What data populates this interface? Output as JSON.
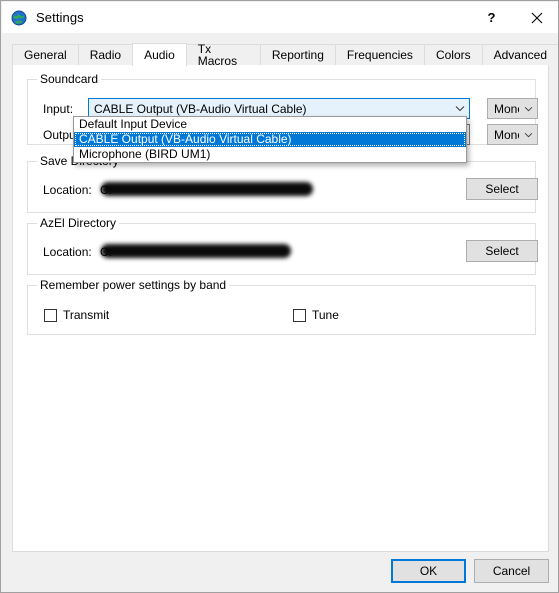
{
  "window": {
    "title": "Settings",
    "icon": "globe-icon",
    "help_label": "?",
    "close_label": "✕"
  },
  "tabs": [
    {
      "label": "General",
      "active": false
    },
    {
      "label": "Radio",
      "active": false
    },
    {
      "label": "Audio",
      "active": true
    },
    {
      "label": "Tx Macros",
      "active": false
    },
    {
      "label": "Reporting",
      "active": false
    },
    {
      "label": "Frequencies",
      "active": false
    },
    {
      "label": "Colors",
      "active": false
    },
    {
      "label": "Advanced",
      "active": false
    }
  ],
  "soundcard": {
    "title": "Soundcard",
    "input": {
      "label": "Input:",
      "value": "CABLE Output (VB-Audio Virtual Cable)",
      "channel_value": "Mono",
      "expanded": true,
      "options": [
        {
          "label": "Default Input Device",
          "selected": false
        },
        {
          "label": "CABLE Output (VB-Audio Virtual Cable)",
          "selected": true
        },
        {
          "label": "Microphone (BIRD UM1)",
          "selected": false
        }
      ]
    },
    "output": {
      "label": "Output:",
      "value": "",
      "channel_value": "Mono"
    }
  },
  "save_directory": {
    "title": "Save Directory",
    "location_label": "Location:",
    "location_value": "C:",
    "location_redacted": true,
    "select_label": "Select"
  },
  "azel_directory": {
    "title": "AzEl Directory",
    "location_label": "Location:",
    "location_value": "C:",
    "location_redacted": true,
    "select_label": "Select"
  },
  "power_settings": {
    "title": "Remember power settings by band",
    "checkboxes": [
      {
        "label": "Transmit",
        "checked": false
      },
      {
        "label": "Tune",
        "checked": false
      }
    ]
  },
  "footer": {
    "ok_label": "OK",
    "cancel_label": "Cancel"
  },
  "colors": {
    "accent": "#0078d7",
    "dialog_bg": "#f0f0f0",
    "panel_bg": "#ffffff",
    "button_bg": "#e1e1e1",
    "combo_open_bg": "#e5f1fb",
    "group_border": "#dfdfdf"
  }
}
